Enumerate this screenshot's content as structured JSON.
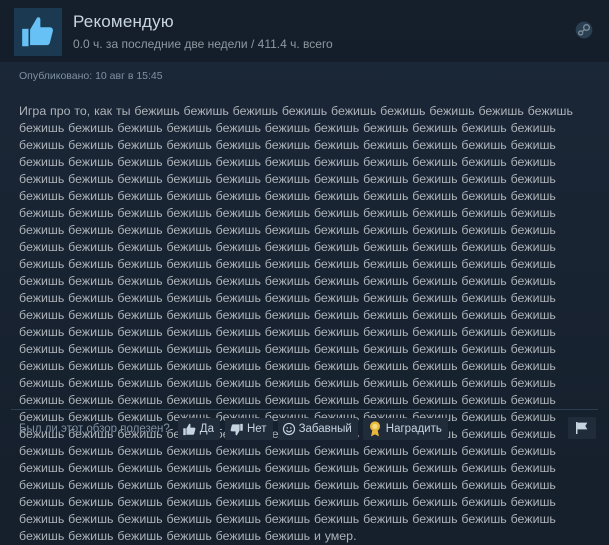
{
  "header": {
    "verdict": "Рекомендую",
    "hours": "0.0 ч. за последние две недели / 411.4 ч. всего",
    "thumb_icon": "thumbs-up-icon",
    "platform_icon": "steam-icon"
  },
  "posted": "Опубликовано: 10 авг в 15:45",
  "review_text": "Игра про то, как ты бежишь бежишь бежишь бежишь бежишь бежишь бежишь бежишь бежишь бежишь бежишь бежишь бежишь бежишь бежишь бежишь бежишь бежишь бежишь бежишь бежишь бежишь бежишь бежишь бежишь бежишь бежишь бежишь бежишь бежишь бежишь бежишь бежишь бежишь бежишь бежишь бежишь бежишь бежишь бежишь бежишь бежишь бежишь бежишь бежишь бежишь бежишь бежишь бежишь бежишь бежишь бежишь бежишь бежишь бежишь бежишь бежишь бежишь бежишь бежишь бежишь бежишь бежишь бежишь бежишь бежишь бежишь бежишь бежишь бежишь бежишь бежишь бежишь бежишь бежишь бежишь бежишь бежишь бежишь бежишь бежишь бежишь бежишь бежишь бежишь бежишь бежишь бежишь бежишь бежишь бежишь бежишь бежишь бежишь бежишь бежишь бежишь бежишь бежишь бежишь бежишь бежишь бежишь бежишь бежишь бежишь бежишь бежишь бежишь бежишь бежишь бежишь бежишь бежишь бежишь бежишь бежишь бежишь бежишь бежишь бежишь бежишь бежишь бежишь бежишь бежишь бежишь бежишь бежишь бежишь бежишь бежишь бежишь бежишь бежишь бежишь бежишь бежишь бежишь бежишь бежишь бежишь бежишь бежишь бежишь бежишь бежишь бежишь бежишь бежишь бежишь бежишь бежишь бежишь бежишь бежишь бежишь бежишь бежишь бежишь бежишь бежишь бежишь бежишь бежишь бежишь бежишь бежишь бежишь бежишь бежишь бежишь бежишь бежишь бежишь бежишь бежишь бежишь бежишь бежишь бежишь бежишь бежишь бежишь бежишь бежишь бежишь бежишь бежишь бежишь бежишь бежишь бежишь бежишь бежишь бежишь бежишь бежишь бежишь бежишь бежишь бежишь бежишь бежишь бежишь бежишь бежишь бежишь бежишь бежишь бежишь бежишь бежишь бежишь бежишь бежишь бежишь бежишь бежишь бежишь бежишь бежишь бежишь бежишь бежишь бежишь бежишь бежишь бежишь бежишь бежишь бежишь бежишь бежишь бежишь бежишь бежишь бежишь бежишь бежишь бежишь бежишь бежишь бежишь бежишь бежишь бежишь бежишь бежишь бежишь бежишь бежишь бежишь бежишь бежишь бежишь бежишь бежишь бежишь бежишь бежишь бежишь бежишь бежишь бежишь бежишь бежишь бежишь бежишь бежишь бежишь бежишь бежишь бежишь бежишь бежишь бежишь бежишь бежишь и умер.",
  "footer": {
    "question": "Был ли этот обзор полезен?",
    "yes_label": "Да",
    "yes_icon": "thumbs-up-icon",
    "no_label": "Нет",
    "no_icon": "thumbs-down-icon",
    "funny_label": "Забавный",
    "funny_icon": "smiley-icon",
    "award_label": "Наградить",
    "award_icon": "award-icon",
    "flag_icon": "flag-icon"
  },
  "colors": {
    "background": "#1b2838",
    "accent_blue": "#67c1f5",
    "award_gold": "#e8b83a"
  }
}
